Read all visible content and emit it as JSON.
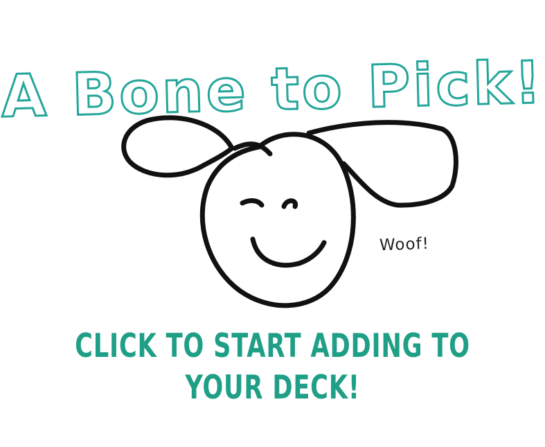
{
  "page": {
    "title": "A Bone to Pick!",
    "woof_text": "Woof!",
    "cta": {
      "line1": "CLICK TO START ADDING TO",
      "line2": "YOUR DECK!"
    }
  },
  "colors": {
    "title_stroke": "#24a69a",
    "cta_text": "#1f9f86",
    "sketch_line": "#111111"
  },
  "icons": {
    "dog": "hand-drawn-dog-face"
  }
}
